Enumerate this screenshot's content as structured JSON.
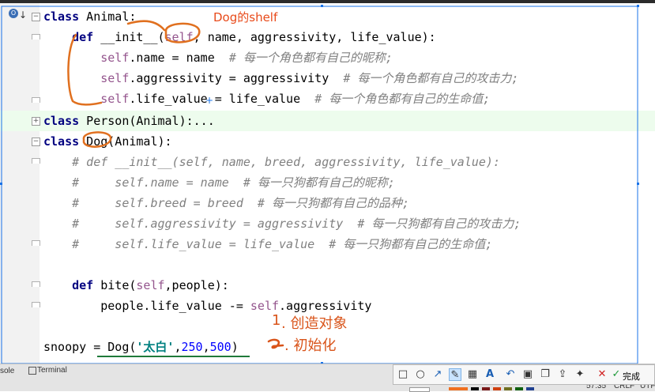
{
  "code": {
    "l1": {
      "kw": "class",
      "rest": " Animal:"
    },
    "l2": {
      "indent": "    ",
      "kw": "def",
      "a": " __init__(",
      "self": "self",
      "b": ", name, aggressivity, life_value):"
    },
    "l3": {
      "indent": "        ",
      "self": "self",
      "a": ".name = name  ",
      "cm": "# 每一个角色都有自己的昵称;"
    },
    "l4": {
      "indent": "        ",
      "self": "self",
      "a": ".aggressivity = aggressivity  ",
      "cm": "# 每一个角色都有自己的攻击力;"
    },
    "l5": {
      "indent": "        ",
      "self": "self",
      "a": ".life_value = life_value  ",
      "cm": "# 每一个角色都有自己的生命值;"
    },
    "l6": {
      "kw": "class",
      "rest": " Person(Animal):..."
    },
    "l7": {
      "kw": "class",
      "rest": " Dog(Animal):"
    },
    "l8": {
      "text": "    # def __init__(self, name, breed, aggressivity, life_value):"
    },
    "l9": {
      "text": "    #     self.name = name  # 每一只狗都有自己的昵称;"
    },
    "l10": {
      "text": "    #     self.breed = breed  # 每一只狗都有自己的品种;"
    },
    "l11": {
      "text": "    #     self.aggressivity = aggressivity  # 每一只狗都有自己的攻击力;"
    },
    "l12": {
      "text": "    #     self.life_value = life_value  # 每一只狗都有自己的生命值;"
    },
    "l13": {
      "indent": "    ",
      "kw": "def",
      "rest": " bite(",
      "self": "self",
      "b": ",people):"
    },
    "l14": {
      "indent": "        ",
      "a": "people.life_value -= ",
      "self": "self",
      "b": ".aggressivity"
    },
    "l15": {
      "a": "snoopy = Dog(",
      "str": "'太白'",
      "c1": ",",
      "n1": "250",
      "c2": ",",
      "n2": "500",
      "end": ")"
    }
  },
  "annotations": {
    "dog_self": "Dog的shelf",
    "step1_num": "1",
    "step1_text": ". 创造对象",
    "step2_num": "2",
    "step2_text": ". 初始化"
  },
  "status": {
    "left": "sole",
    "terminal": "Terminal",
    "pos": "57:35",
    "crlf": "CRLF",
    "enc": "UTF"
  },
  "toolbar": {
    "done": "完成",
    "icons": [
      "rectangle-icon",
      "ellipse-icon",
      "arrow-icon",
      "pen-icon",
      "mosaic-icon",
      "text-icon",
      "undo-icon",
      "save-icon",
      "copy-icon",
      "share-icon",
      "pin-icon",
      "close-icon",
      "check-icon"
    ]
  },
  "colors": {
    "annotation": "#d9541a",
    "underline": "#1f7a3a",
    "keyword": "#000080",
    "self": "#94558d",
    "comment": "#808080"
  }
}
